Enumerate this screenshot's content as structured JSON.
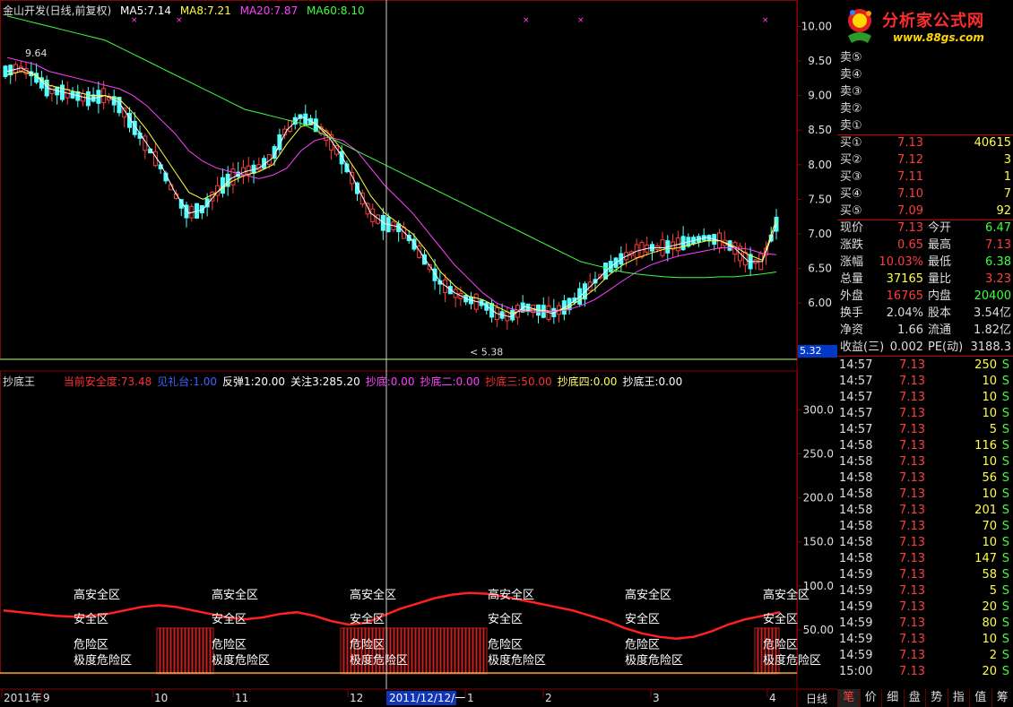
{
  "header": {
    "title": "金山开发(日线,前复权)",
    "ma5": "MA5:7.14",
    "ma8": "MA8:7.21",
    "ma20": "MA20:7.87",
    "ma60": "MA60:8.10",
    "high_label": "9.64",
    "low_label": "5.38"
  },
  "indicator": {
    "name": "抄底王",
    "items": [
      {
        "text": "当前安全度:73.48",
        "color": "#ff3030"
      },
      {
        "text": "见礼台:1.00",
        "color": "#4060ff"
      },
      {
        "text": "反弹1:20.00",
        "color": "#ffffff"
      },
      {
        "text": "关注3:285.20",
        "color": "#ffffff"
      },
      {
        "text": "抄底:0.00",
        "color": "#ff40ff"
      },
      {
        "text": "抄底二:0.00",
        "color": "#ff40ff"
      },
      {
        "text": "抄底三:50.00",
        "color": "#ff3030"
      },
      {
        "text": "抄底四:0.00",
        "color": "#ffff60"
      },
      {
        "text": "抄底王:0.00",
        "color": "#ffffff"
      }
    ],
    "zone_labels": [
      "高安全区",
      "安全区",
      "危险区",
      "极度危险区"
    ]
  },
  "price_axis": [
    "10.00",
    "9.50",
    "9.00",
    "8.50",
    "8.00",
    "7.50",
    "7.00",
    "6.50",
    "6.00"
  ],
  "indicator_axis": [
    "300.0",
    "250.0",
    "200.0",
    "150.0",
    "100.0",
    "50.00"
  ],
  "current_price_tag": "5.32",
  "date_axis": [
    "2011年",
    "9",
    "10",
    "11",
    "12",
    "1",
    "2",
    "3",
    "4"
  ],
  "cursor_date": "2011/12/12/一",
  "period_button": "日线",
  "logo": {
    "title": "分析家公式网",
    "url": "www.88gs.com"
  },
  "order_book": {
    "sells": [
      {
        "label": "卖⑤",
        "price": "",
        "vol": ""
      },
      {
        "label": "卖④",
        "price": "",
        "vol": ""
      },
      {
        "label": "卖③",
        "price": "",
        "vol": ""
      },
      {
        "label": "卖②",
        "price": "",
        "vol": ""
      },
      {
        "label": "卖①",
        "price": "",
        "vol": ""
      }
    ],
    "buys": [
      {
        "label": "买①",
        "price": "7.13",
        "vol": "40615"
      },
      {
        "label": "买②",
        "price": "7.12",
        "vol": "3"
      },
      {
        "label": "买③",
        "price": "7.11",
        "vol": "1"
      },
      {
        "label": "买④",
        "price": "7.10",
        "vol": "7"
      },
      {
        "label": "买⑤",
        "price": "7.09",
        "vol": "92"
      }
    ]
  },
  "quote": [
    {
      "a": "现价",
      "b": "7.13",
      "bc": "#ff3d3d",
      "c": "今开",
      "d": "6.47",
      "dc": "#3dff3d"
    },
    {
      "a": "涨跌",
      "b": "0.65",
      "bc": "#ff3d3d",
      "c": "最高",
      "d": "7.13",
      "dc": "#ff3d3d"
    },
    {
      "a": "涨幅",
      "b": "10.03%",
      "bc": "#ff3d3d",
      "c": "最低",
      "d": "6.38",
      "dc": "#3dff3d"
    },
    {
      "a": "总量",
      "b": "37165",
      "bc": "#ffff40",
      "c": "量比",
      "d": "3.23",
      "dc": "#ff3d3d"
    },
    {
      "a": "外盘",
      "b": "16765",
      "bc": "#ff3d3d",
      "c": "内盘",
      "d": "20400",
      "dc": "#3dff3d"
    },
    {
      "a": "换手",
      "b": "2.04%",
      "bc": "#ddd",
      "c": "股本",
      "d": "3.54亿",
      "dc": "#ddd"
    },
    {
      "a": "净资",
      "b": "1.66",
      "bc": "#ddd",
      "c": "流通",
      "d": "1.82亿",
      "dc": "#ddd"
    },
    {
      "a": "收益(三)",
      "b": "0.002",
      "bc": "#ddd",
      "c": "PE(动)",
      "d": "3188.3",
      "dc": "#ddd"
    }
  ],
  "ticks": [
    {
      "t": "14:57",
      "p": "7.13",
      "v": "250",
      "vc": "#ffff40",
      "s": "S"
    },
    {
      "t": "14:57",
      "p": "7.13",
      "v": "10",
      "vc": "#ffff40",
      "s": "S"
    },
    {
      "t": "14:57",
      "p": "7.13",
      "v": "10",
      "vc": "#ffff40",
      "s": "S"
    },
    {
      "t": "14:57",
      "p": "7.13",
      "v": "10",
      "vc": "#ffff40",
      "s": "S"
    },
    {
      "t": "14:57",
      "p": "7.13",
      "v": "5",
      "vc": "#ffff40",
      "s": "S"
    },
    {
      "t": "14:58",
      "p": "7.13",
      "v": "116",
      "vc": "#ffff40",
      "s": "S"
    },
    {
      "t": "14:58",
      "p": "7.13",
      "v": "10",
      "vc": "#ffff40",
      "s": "S"
    },
    {
      "t": "14:58",
      "p": "7.13",
      "v": "56",
      "vc": "#ffff40",
      "s": "S"
    },
    {
      "t": "14:58",
      "p": "7.13",
      "v": "10",
      "vc": "#ffff40",
      "s": "S"
    },
    {
      "t": "14:58",
      "p": "7.13",
      "v": "201",
      "vc": "#ffff40",
      "s": "S"
    },
    {
      "t": "14:58",
      "p": "7.13",
      "v": "70",
      "vc": "#ffff40",
      "s": "S"
    },
    {
      "t": "14:58",
      "p": "7.13",
      "v": "10",
      "vc": "#ffff40",
      "s": "S"
    },
    {
      "t": "14:58",
      "p": "7.13",
      "v": "147",
      "vc": "#ffff40",
      "s": "S"
    },
    {
      "t": "14:59",
      "p": "7.13",
      "v": "58",
      "vc": "#ffff40",
      "s": "S"
    },
    {
      "t": "14:59",
      "p": "7.13",
      "v": "5",
      "vc": "#ffff40",
      "s": "S"
    },
    {
      "t": "14:59",
      "p": "7.13",
      "v": "20",
      "vc": "#ffff40",
      "s": "S"
    },
    {
      "t": "14:59",
      "p": "7.13",
      "v": "80",
      "vc": "#ffff40",
      "s": "S"
    },
    {
      "t": "14:59",
      "p": "7.13",
      "v": "10",
      "vc": "#ffff40",
      "s": "S"
    },
    {
      "t": "14:59",
      "p": "7.13",
      "v": "2",
      "vc": "#ffff40",
      "s": "S"
    },
    {
      "t": "15:00",
      "p": "7.13",
      "v": "20",
      "vc": "#ffff40",
      "s": "S"
    }
  ],
  "tabs": [
    "笔",
    "价",
    "细",
    "盘",
    "势",
    "指",
    "值",
    "筹"
  ],
  "chart_data": {
    "type": "line",
    "title": "金山开发(日线,前复权)",
    "ylim": [
      5.2,
      10.2
    ],
    "series": [
      {
        "name": "MA5",
        "color": "#ffffff",
        "values": [
          9.35,
          9.4,
          9.3,
          9.1,
          9.05,
          9.0,
          8.95,
          9.0,
          8.9,
          8.6,
          8.3,
          8.0,
          7.6,
          7.3,
          7.35,
          7.6,
          7.8,
          7.9,
          7.95,
          8.1,
          8.5,
          8.7,
          8.6,
          8.4,
          8.1,
          7.7,
          7.3,
          7.15,
          7.1,
          6.9,
          6.6,
          6.3,
          6.15,
          6.05,
          6.0,
          5.85,
          5.8,
          5.95,
          5.9,
          5.85,
          5.95,
          6.1,
          6.3,
          6.5,
          6.65,
          6.75,
          6.8,
          6.8,
          6.85,
          6.9,
          6.95,
          6.9,
          6.8,
          6.6,
          6.6,
          7.14
        ]
      },
      {
        "name": "MA8",
        "color": "#ffff40",
        "values": [
          9.3,
          9.35,
          9.3,
          9.15,
          9.1,
          9.05,
          9.0,
          9.0,
          8.95,
          8.75,
          8.5,
          8.2,
          7.9,
          7.6,
          7.5,
          7.6,
          7.75,
          7.85,
          7.9,
          8.0,
          8.3,
          8.55,
          8.6,
          8.45,
          8.2,
          7.9,
          7.55,
          7.3,
          7.15,
          7.0,
          6.75,
          6.45,
          6.25,
          6.1,
          6.05,
          5.95,
          5.85,
          5.9,
          5.9,
          5.88,
          5.92,
          6.05,
          6.2,
          6.4,
          6.55,
          6.65,
          6.72,
          6.78,
          6.8,
          6.85,
          6.9,
          6.9,
          6.82,
          6.7,
          6.62,
          7.21
        ]
      },
      {
        "name": "MA20",
        "color": "#ff40ff",
        "values": [
          9.55,
          9.5,
          9.45,
          9.35,
          9.3,
          9.25,
          9.2,
          9.15,
          9.1,
          9.0,
          8.85,
          8.65,
          8.45,
          8.2,
          8.05,
          7.95,
          7.9,
          7.85,
          7.8,
          7.85,
          7.95,
          8.2,
          8.35,
          8.4,
          8.35,
          8.2,
          7.95,
          7.7,
          7.5,
          7.3,
          7.05,
          6.8,
          6.55,
          6.35,
          6.15,
          6.0,
          5.92,
          5.88,
          5.87,
          5.88,
          5.9,
          5.96,
          6.05,
          6.18,
          6.32,
          6.45,
          6.55,
          6.62,
          6.68,
          6.72,
          6.76,
          6.8,
          6.8,
          6.78,
          6.72,
          6.7
        ]
      },
      {
        "name": "MA60",
        "color": "#40ff40",
        "values": [
          10.15,
          10.1,
          10.05,
          10.0,
          9.95,
          9.9,
          9.85,
          9.8,
          9.7,
          9.6,
          9.5,
          9.4,
          9.3,
          9.2,
          9.1,
          9.0,
          8.9,
          8.8,
          8.75,
          8.7,
          8.65,
          8.6,
          8.5,
          8.4,
          8.3,
          8.2,
          8.1,
          8.0,
          7.9,
          7.8,
          7.7,
          7.6,
          7.5,
          7.4,
          7.3,
          7.2,
          7.1,
          7.0,
          6.9,
          6.8,
          6.7,
          6.6,
          6.55,
          6.5,
          6.45,
          6.42,
          6.4,
          6.38,
          6.37,
          6.37,
          6.37,
          6.38,
          6.38,
          6.4,
          6.42,
          6.45
        ]
      }
    ]
  },
  "colors": {
    "up": "#ff3d3d",
    "down": "#54ffff",
    "grid": "#8b0000",
    "axis_text": "#e0e0e0",
    "safety_line": "#ff2020",
    "bars": "#c81e1e"
  }
}
